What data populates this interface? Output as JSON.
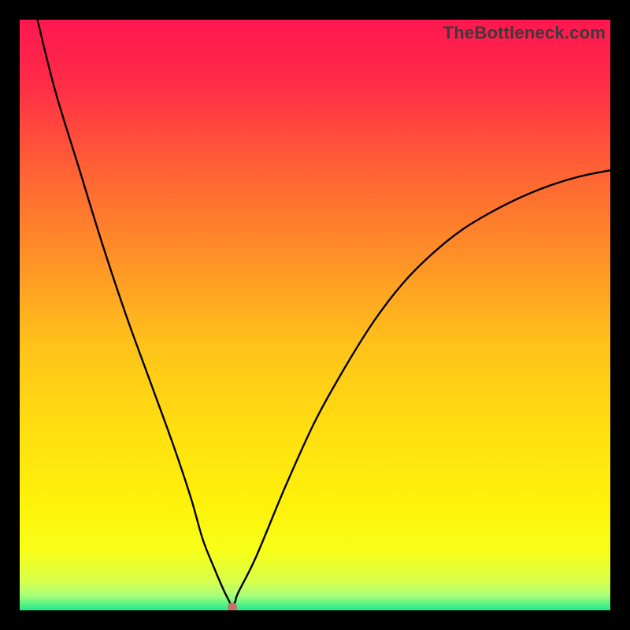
{
  "watermark": {
    "text": "TheBottleneck.com"
  },
  "chart_data": {
    "type": "line",
    "title": "",
    "xlabel": "",
    "ylabel": "",
    "xlim": [
      0,
      100
    ],
    "ylim": [
      0,
      100
    ],
    "grid": false,
    "legend": false,
    "gradient_stops": [
      {
        "offset": 0.0,
        "color": "#ff1750"
      },
      {
        "offset": 0.1,
        "color": "#ff2a48"
      },
      {
        "offset": 0.25,
        "color": "#ff6035"
      },
      {
        "offset": 0.4,
        "color": "#ff9027"
      },
      {
        "offset": 0.55,
        "color": "#ffc21a"
      },
      {
        "offset": 0.7,
        "color": "#ffe010"
      },
      {
        "offset": 0.82,
        "color": "#fff20a"
      },
      {
        "offset": 0.9,
        "color": "#f7ff18"
      },
      {
        "offset": 0.95,
        "color": "#d9ff4a"
      },
      {
        "offset": 0.975,
        "color": "#a8ff7a"
      },
      {
        "offset": 1.0,
        "color": "#20e88a"
      }
    ],
    "series": [
      {
        "name": "bottleneck-curve",
        "x": [
          3,
          6,
          10,
          14,
          18,
          22,
          26,
          29,
          31,
          33,
          34.5,
          35.5,
          36,
          36.5,
          37,
          40,
          45,
          50,
          55,
          60,
          65,
          70,
          75,
          80,
          85,
          90,
          95,
          100
        ],
        "y": [
          100,
          88,
          75,
          62,
          50,
          39,
          28,
          19,
          12,
          7,
          3.5,
          1.5,
          0.5,
          1.5,
          3,
          9,
          21,
          32,
          41,
          49,
          55.5,
          60.5,
          64.5,
          67.5,
          70,
          72,
          73.5,
          74.5
        ]
      }
    ],
    "marker": {
      "x": 36,
      "y": 0.5,
      "color": "#c77069",
      "radius_px": 6
    },
    "min_point": {
      "x": 36,
      "y": 0.5
    }
  }
}
